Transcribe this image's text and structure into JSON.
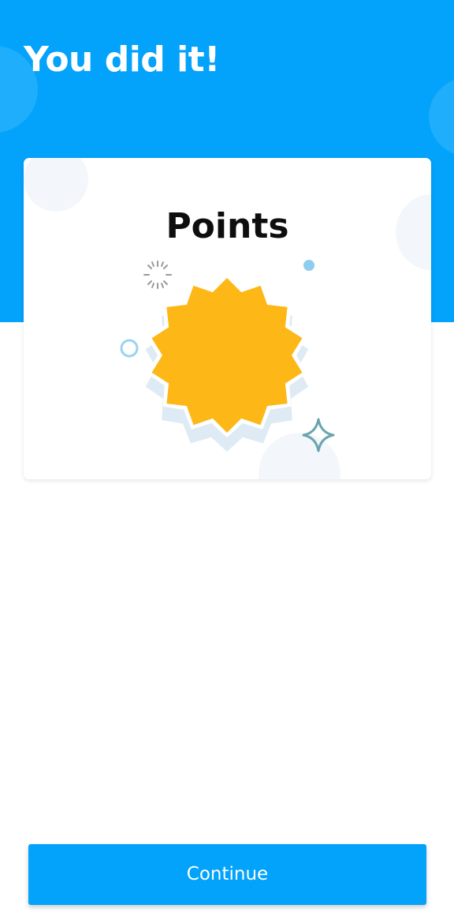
{
  "header": {
    "title": "You did it!"
  },
  "reward_card": {
    "title": "Points",
    "badge_icon": "starburst-badge"
  },
  "footer": {
    "continue_label": "Continue"
  },
  "colors": {
    "primary": "#03a2fb",
    "badge": "#fdb817",
    "text_dark": "#0e0e0e",
    "white": "#ffffff"
  }
}
